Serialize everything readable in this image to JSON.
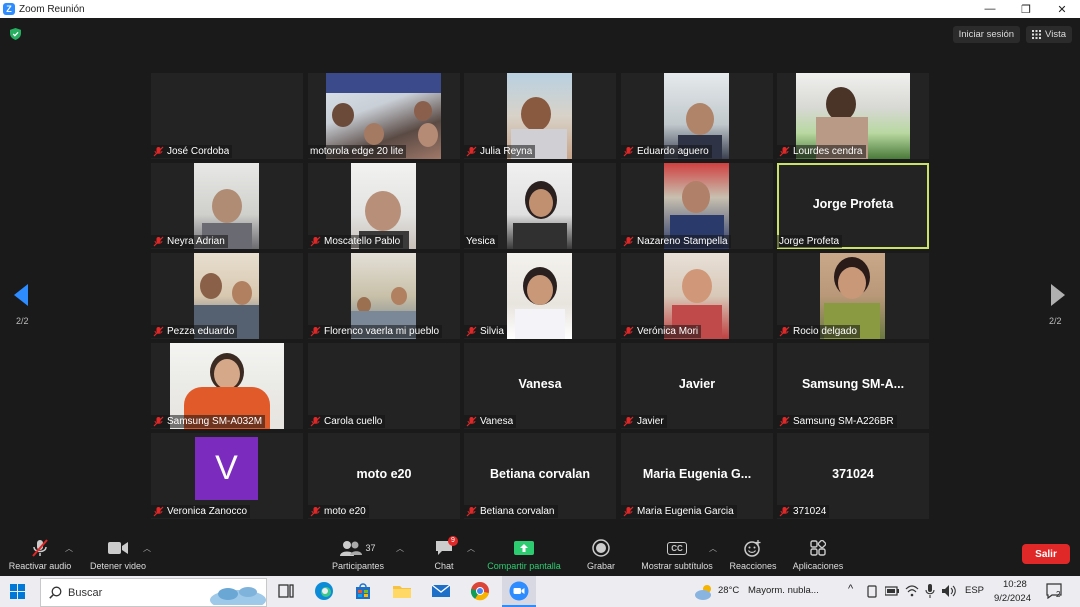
{
  "window": {
    "title": "Zoom Reunión",
    "min": "—",
    "max": "❐",
    "close": "✕"
  },
  "top_right": {
    "signin_label": "Iniciar sesión",
    "view_label": "Vista"
  },
  "pagination": {
    "left": "2/2",
    "right": "2/2"
  },
  "tiles": [
    {
      "name": "José Cordoba",
      "muted": true,
      "video": false,
      "big": ""
    },
    {
      "name": "motorola edge 20 lite",
      "muted": false,
      "video": true,
      "big": ""
    },
    {
      "name": "Julia Reyna",
      "muted": true,
      "video": true,
      "big": ""
    },
    {
      "name": "Eduardo aguero",
      "muted": true,
      "video": true,
      "big": ""
    },
    {
      "name": "Lourdes cendra",
      "muted": true,
      "video": true,
      "big": ""
    },
    {
      "name": "Neyra Adrian",
      "muted": true,
      "video": true,
      "big": ""
    },
    {
      "name": "Moscatello Pablo",
      "muted": true,
      "video": true,
      "big": ""
    },
    {
      "name": "Yesica",
      "muted": false,
      "video": true,
      "big": ""
    },
    {
      "name": "Nazareno Stampella",
      "muted": true,
      "video": true,
      "big": ""
    },
    {
      "name": "Jorge Profeta",
      "muted": false,
      "video": false,
      "big": "Jorge Profeta",
      "active": true
    },
    {
      "name": "Pezza eduardo",
      "muted": true,
      "video": true,
      "big": ""
    },
    {
      "name": "Florenco vaerla mi pueblo",
      "muted": true,
      "video": true,
      "big": ""
    },
    {
      "name": "Silvia",
      "muted": true,
      "video": true,
      "big": ""
    },
    {
      "name": "Verónica Mori",
      "muted": true,
      "video": true,
      "big": ""
    },
    {
      "name": "Rocio delgado",
      "muted": true,
      "video": true,
      "big": ""
    },
    {
      "name": "Samsung SM-A032M",
      "muted": true,
      "video": true,
      "big": ""
    },
    {
      "name": "Carola cuello",
      "muted": true,
      "video": false,
      "big": ""
    },
    {
      "name": "Vanesa",
      "muted": true,
      "video": false,
      "big": "Vanesa"
    },
    {
      "name": "Javier",
      "muted": true,
      "video": false,
      "big": "Javier"
    },
    {
      "name": "Samsung SM-A226BR",
      "muted": true,
      "video": false,
      "big": "Samsung  SM-A..."
    },
    {
      "name": "Veronica Zanocco",
      "muted": true,
      "video": false,
      "big": "",
      "avatar": "V"
    },
    {
      "name": "moto e20",
      "muted": true,
      "video": false,
      "big": "moto e20"
    },
    {
      "name": "Betiana corvalan",
      "muted": true,
      "video": false,
      "big": "Betiana corvalan"
    },
    {
      "name": "Maria Eugenia Garcia",
      "muted": true,
      "video": false,
      "big": "Maria  Eugenia  G..."
    },
    {
      "name": "371024",
      "muted": true,
      "video": false,
      "big": "371024"
    }
  ],
  "toolbar": {
    "audio": "Reactivar audio",
    "video": "Detener video",
    "participants": "Participantes",
    "participants_count": "37",
    "chat": "Chat",
    "chat_badge": "9",
    "share": "Compartir pantalla",
    "record": "Grabar",
    "captions": "Mostrar subtítulos",
    "captions_icon": "CC",
    "reactions": "Reacciones",
    "apps": "Aplicaciones",
    "leave": "Salir"
  },
  "taskbar": {
    "search": "Buscar",
    "weather": "28°C",
    "weather_desc": "Mayorm. nubla...",
    "lang": "ESP",
    "time": "10:28",
    "date": "9/2/2024",
    "notif_count": "2"
  },
  "colors": {
    "accent_blue": "#2d8cff",
    "active_border": "#c9e265",
    "leave_red": "#e02828",
    "share_green": "#2ecc71",
    "mute_red": "#e02828"
  }
}
